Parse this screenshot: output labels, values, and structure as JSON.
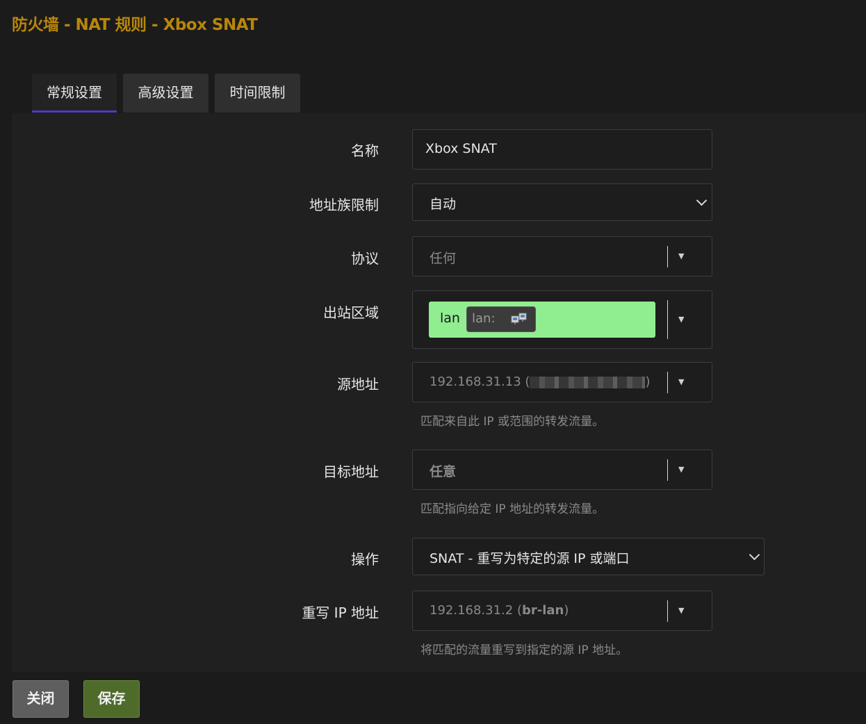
{
  "title": "防火墙 - NAT 规则 - Xbox SNAT",
  "tabs": [
    {
      "label": "常规设置",
      "active": true
    },
    {
      "label": "高级设置",
      "active": false
    },
    {
      "label": "时间限制",
      "active": false
    }
  ],
  "form": {
    "name": {
      "label": "名称",
      "value": "Xbox SNAT"
    },
    "family": {
      "label": "地址族限制",
      "value": "自动"
    },
    "protocol": {
      "label": "协议",
      "value": "任何"
    },
    "out_zone": {
      "label": "出站区域",
      "zone": "lan",
      "badge": "lan:",
      "chip_color": "#90ee90",
      "icon": "network-interface-icon"
    },
    "src_addr": {
      "label": "源地址",
      "value_prefix": "192.168.31.13 (",
      "value_suffix": ")",
      "help": "匹配来自此 IP 或范围的转发流量。"
    },
    "dst_addr": {
      "label": "目标地址",
      "value": "任意",
      "help": "匹配指向给定 IP 地址的转发流量。"
    },
    "action": {
      "label": "操作",
      "value": "SNAT - 重写为特定的源 IP 或端口"
    },
    "rewrite_ip": {
      "label": "重写 IP 地址",
      "value_ip": "192.168.31.2 (",
      "value_iface": "br-lan",
      "value_end": ")",
      "help": "将匹配的流量重写到指定的源 IP 地址。"
    }
  },
  "buttons": {
    "close": "关闭",
    "save": "保存"
  },
  "colors": {
    "title": "#b8860b",
    "tab_active_underline": "#4a3fbf",
    "save_button": "#4e6b2a"
  }
}
